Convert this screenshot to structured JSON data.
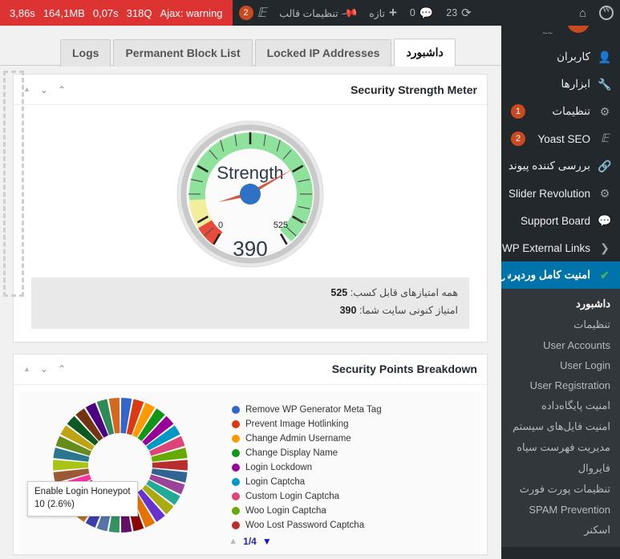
{
  "adminbar": {
    "query_monitor": {
      "time": "3,86s",
      "memory": "164,1MB",
      "db_time": "0,07s",
      "queries": "318Q",
      "ajax": "Ajax: warning",
      "warning_count": "2",
      "bg_color": "#dd3333"
    },
    "items": [
      {
        "name": "wp-logo",
        "icon": "wordpress-icon",
        "label": ""
      },
      {
        "name": "site-name",
        "icon": "home-icon",
        "label": ""
      },
      {
        "name": "updates",
        "icon": "refresh-icon",
        "label": "23"
      },
      {
        "name": "comments",
        "icon": "comment-icon",
        "label": "0"
      },
      {
        "name": "new-content",
        "icon": "plus-icon",
        "label": "تازه"
      },
      {
        "name": "theme-settings",
        "icon": "pin-icon",
        "label": "تنظیمات قالب"
      },
      {
        "name": "yoast-seo",
        "icon": "yoast-icon",
        "label": "2"
      }
    ]
  },
  "sidebar": {
    "items": [
      {
        "label": "کاربران",
        "icon": "users-icon",
        "badge": "",
        "current": false
      },
      {
        "label": "ابزارها",
        "icon": "tools-icon",
        "badge": "",
        "current": false
      },
      {
        "label": "تنظیمات",
        "icon": "settings-icon",
        "badge": "1",
        "current": false
      },
      {
        "label": "Yoast SEO",
        "icon": "yoast-icon",
        "badge": "2",
        "current": false
      },
      {
        "label": "بررسی کننده پیوند",
        "icon": "link-checker-icon",
        "badge": "",
        "current": false
      },
      {
        "label": "Slider Revolution",
        "icon": "slider-icon",
        "badge": "",
        "current": false
      },
      {
        "label": "Support Board",
        "icon": "support-icon",
        "badge": "",
        "current": false
      },
      {
        "label": "WP External Links",
        "icon": "external-link-icon",
        "badge": "",
        "current": false
      },
      {
        "label": "امنیت کامل وردپرس",
        "icon": "shield-check-icon",
        "badge": "",
        "current": true
      }
    ],
    "submenu": [
      {
        "label": "داشبورد",
        "current": true
      },
      {
        "label": "تنظیمات",
        "current": false
      },
      {
        "label": "User Accounts",
        "current": false
      },
      {
        "label": "User Login",
        "current": false
      },
      {
        "label": "User Registration",
        "current": false
      },
      {
        "label": "امنیت پایگاه‌داده",
        "current": false
      },
      {
        "label": "امنیت فایل‌های سیستم",
        "current": false
      },
      {
        "label": "مدیریت فهرست سیاه",
        "current": false
      },
      {
        "label": "فایروال",
        "current": false
      },
      {
        "label": "تنظیمات پورت فورث",
        "current": false
      },
      {
        "label": "SPAM Prevention",
        "current": false
      },
      {
        "label": "اسکنر",
        "current": false
      }
    ]
  },
  "tabs": [
    {
      "label": "Logs",
      "active": false
    },
    {
      "label": "Permanent Block List",
      "active": false
    },
    {
      "label": "Locked IP Addresses",
      "active": false
    },
    {
      "label": "داشبورد",
      "active": true
    }
  ],
  "panels": {
    "strength_meter": {
      "title": "Security Strength Meter",
      "controls": {
        "collapse": "▲",
        "down": "⌄",
        "up": "⌃"
      },
      "footer_total_label": "همه امتیازهای قابل کسب:",
      "footer_total_value": "525",
      "footer_current_label": "امتیاز کنونی سایت شما:",
      "footer_current_value": "390"
    },
    "points_breakdown": {
      "title": "Security Points Breakdown",
      "controls": {
        "collapse": "▲",
        "down": "⌄",
        "up": "⌃"
      },
      "pager": {
        "prev": "▲",
        "page": "1/4",
        "next": "▼"
      },
      "tooltip": {
        "label": "Enable Login Honeypot",
        "value": "10 (2.6%)"
      }
    }
  },
  "chart_data": [
    {
      "type": "gauge",
      "title": "Strength",
      "value": 390,
      "value_label": "390",
      "min": 0,
      "max": 525,
      "min_label": "0",
      "max_label": "525",
      "bands": [
        {
          "from": 0,
          "to": 35,
          "color": "#ea4c3b"
        },
        {
          "from": 35,
          "to": 115,
          "color": "#f2e98f"
        },
        {
          "from": 115,
          "to": 525,
          "color": "#90e39a"
        }
      ],
      "needle_color": "#d9563f",
      "hub_color": "#2f72c4"
    },
    {
      "type": "pie",
      "subtype": "donut",
      "title": "Security Points Breakdown",
      "legend_position": "right",
      "labels": [
        "Remove WP Generator Meta Tag",
        "Prevent Image Hotlinking",
        "Change Admin Username",
        "Change Display Name",
        "Login Lockdown",
        "Login Captcha",
        "Custom Login Captcha",
        "Woo Login Captcha",
        "Woo Lost Password Captcha"
      ],
      "colors": [
        "#3366cc",
        "#dc3912",
        "#ff9900",
        "#109618",
        "#990099",
        "#0099c6",
        "#dd4477",
        "#66aa00",
        "#b82e2e"
      ],
      "highlighted": {
        "label": "Enable Login Honeypot",
        "value": 10,
        "percent": "2.6%"
      },
      "slice_colors": [
        "#3366cc",
        "#dc3912",
        "#ff9900",
        "#109618",
        "#990099",
        "#0099c6",
        "#dd4477",
        "#66aa00",
        "#b82e2e",
        "#316395",
        "#994499",
        "#22aa99",
        "#aaaa11",
        "#6633cc",
        "#e67300",
        "#8b0707",
        "#651067",
        "#329262",
        "#5574a6",
        "#3b3eac",
        "#b77322",
        "#16d620",
        "#b91383",
        "#f4359e",
        "#9c5935",
        "#a9c413",
        "#2a778d",
        "#668d1c",
        "#bea413",
        "#0c5922",
        "#743411",
        "#4b0082",
        "#2e8b57",
        "#d2691e"
      ],
      "slice_count": 34
    }
  ]
}
